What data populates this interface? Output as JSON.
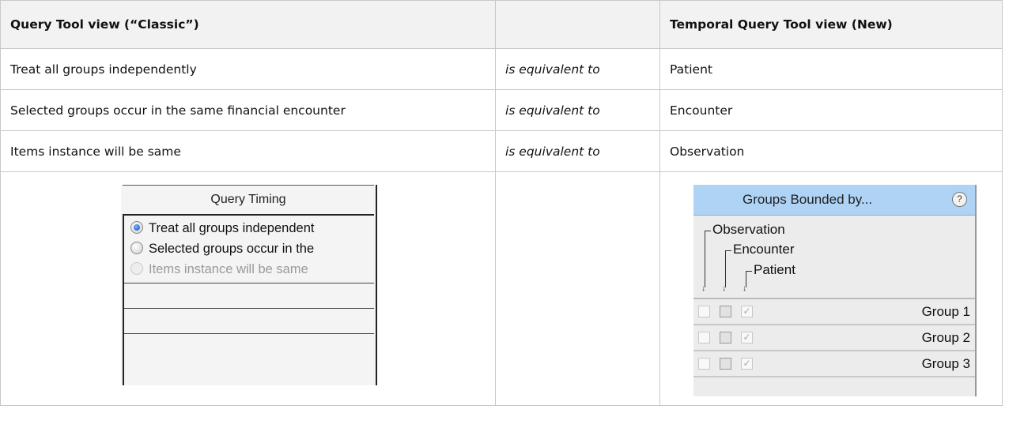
{
  "table": {
    "headers": [
      "Query Tool view (“Classic”)",
      "",
      "Temporal Query Tool view (New)"
    ],
    "rows": [
      {
        "classic": "Treat all groups independently",
        "relation": "is equivalent to",
        "temporal": "Patient"
      },
      {
        "classic": "Selected groups occur in the same financial encounter",
        "relation": "is equivalent to",
        "temporal": "Encounter"
      },
      {
        "classic": "Items instance will be same",
        "relation": "is equivalent to",
        "temporal": "Observation"
      }
    ]
  },
  "classic_panel": {
    "title": "Query Timing",
    "options": [
      {
        "label": "Treat all groups independent",
        "selected": true,
        "disabled": false
      },
      {
        "label": "Selected groups occur in the",
        "selected": false,
        "disabled": false
      },
      {
        "label": "Items instance will be same",
        "selected": false,
        "disabled": true
      }
    ]
  },
  "temporal_panel": {
    "title": "Groups Bounded by...",
    "help_icon": "?",
    "tree": [
      "Observation",
      "Encounter",
      "Patient"
    ],
    "groups": [
      "Group 1",
      "Group 2",
      "Group 3"
    ],
    "header_color": "#aed3f5"
  }
}
